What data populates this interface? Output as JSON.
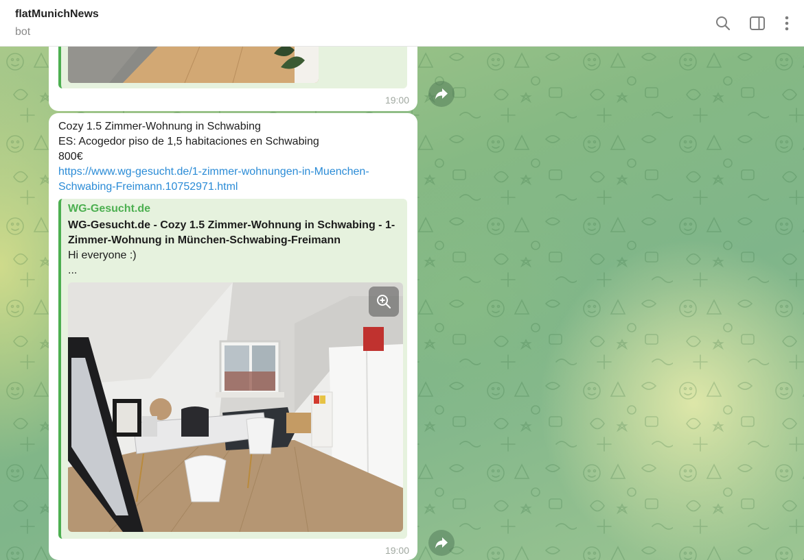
{
  "header": {
    "title": "flatMunichNews",
    "subtitle": "bot",
    "icons": [
      "search-icon",
      "sidebar-toggle-icon",
      "more-vertical-icon"
    ]
  },
  "messages": [
    {
      "time": "19:00"
    },
    {
      "lines": [
        "Cozy 1.5 Zimmer-Wohnung in Schwabing",
        "ES: Acogedor piso de 1,5 habitaciones en Schwabing",
        "800€"
      ],
      "link_lines": [
        "https://www.wg-gesucht.de/1-zimmer-wohnungen-in-Muenchen-",
        "Schwabing-Freimann.10752971.html"
      ],
      "preview": {
        "site": "WG-Gesucht.de",
        "title_lines": [
          "WG-Gesucht.de - Cozy 1.5 Zimmer-Wohnung in Schwabing - 1-",
          "Zimmer-Wohnung in München-Schwabing-Freimann"
        ],
        "description_lines": [
          "Hi everyone :)",
          "..."
        ]
      },
      "time": "19:00"
    }
  ],
  "colors": {
    "link": "#2a8bd6",
    "preview_accent": "#4caf50",
    "preview_bg": "#e6f2de"
  }
}
